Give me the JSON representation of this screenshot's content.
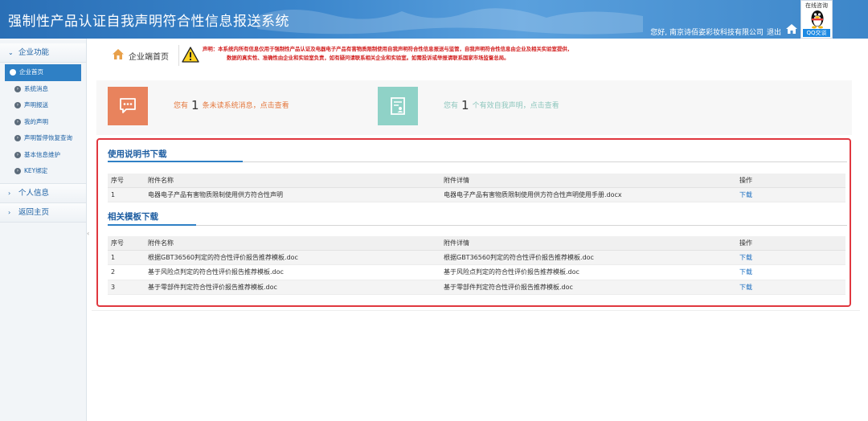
{
  "header": {
    "title": "强制性产品认证自我声明符合性信息报送系统",
    "user_greeting": "您好, 南京诗佰姿彩妆科技有限公司",
    "logout_label": "退出",
    "home_icon": "home-icon",
    "qq": {
      "online_label": "在线咨询",
      "button_label": "QQ交谈",
      "icon": "qq-penguin-icon"
    }
  },
  "sidebar": {
    "group_main": "企业功能",
    "items": [
      {
        "label": "企业首页",
        "active": true
      },
      {
        "label": "系统消息"
      },
      {
        "label": "声明报送"
      },
      {
        "label": "我的声明"
      },
      {
        "label": "声明暂停恢复查询"
      },
      {
        "label": "基本信息维护"
      },
      {
        "label": "KEY绑定"
      }
    ],
    "group_personal": "个人信息",
    "group_return": "返回主页"
  },
  "breadcrumb": {
    "label": "企业端首页"
  },
  "notice": {
    "line1": "声明：本系统内所有信息仅用于强制性产品认证及电器电子产品有害物质限制使用自我声明符合性信息报送与监管，自我声明符合性信息由企业及相关实验室提供，",
    "line2": "数据的真实性、准确性由企业和实验室负责，如有疑问请联系相关企业和实验室。如需投诉或举报请联系国家市场监督总局。"
  },
  "stats": {
    "messages": {
      "prefix": "您有",
      "count": "1",
      "suffix": "条未读系统消息，点击查看"
    },
    "declarations": {
      "prefix": "您有",
      "count": "1",
      "suffix": "个有效自我声明，点击查看"
    }
  },
  "manuals": {
    "title": "使用说明书下载",
    "headers": [
      "序号",
      "附件名称",
      "附件详情",
      "操作"
    ],
    "rows": [
      {
        "no": "1",
        "name": "电器电子产品有害物质限制使用供方符合性声明",
        "detail": "电器电子产品有害物质限制使用供方符合性声明使用手册.docx",
        "action": "下载"
      }
    ]
  },
  "templates": {
    "title": "相关模板下载",
    "headers": [
      "序号",
      "附件名称",
      "附件详情",
      "操作"
    ],
    "rows": [
      {
        "no": "1",
        "name": "根据GBT36560判定的符合性评价报告推荐模板.doc",
        "detail": "根据GBT36560判定的符合性评价报告推荐模板.doc",
        "action": "下载"
      },
      {
        "no": "2",
        "name": "基于风险点判定的符合性评价报告推荐模板.doc",
        "detail": "基于风险点判定的符合性评价报告推荐模板.doc",
        "action": "下载"
      },
      {
        "no": "3",
        "name": "基于零部件判定符合性评价报告推荐模板.doc",
        "detail": "基于零部件判定符合性评价报告推荐模板.doc",
        "action": "下载"
      }
    ]
  }
}
